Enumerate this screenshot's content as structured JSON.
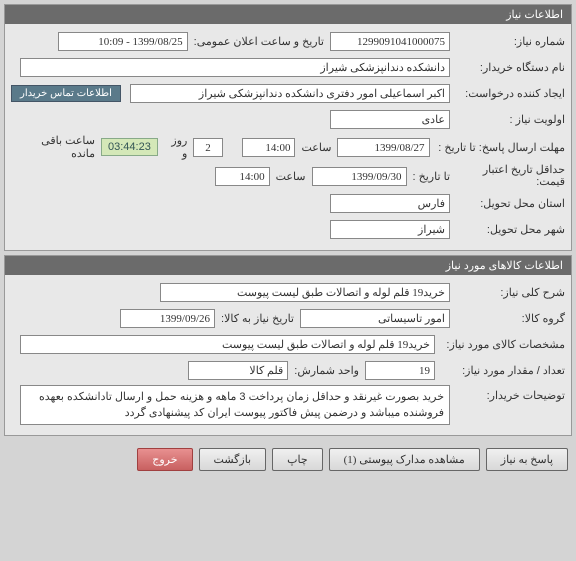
{
  "section1": {
    "title": "اطلاعات نیاز",
    "need_number_label": "شماره نیاز:",
    "need_number": "1299091041000075",
    "publish_label": "تاریخ و ساعت اعلان عمومی:",
    "publish_value": "1399/08/25 - 10:09",
    "buyer_org_label": "نام دستگاه خریدار:",
    "buyer_org": "دانشکده دندانپزشکی شیراز",
    "creator_label": "ایجاد کننده درخواست:",
    "creator": "اکبر اسماعیلی امور دفتری دانشکده دندانپزشکی شیراز",
    "priority_label": "اولویت نیاز :",
    "priority": "عادی",
    "contact_link": "اطلاعات تماس خریدار",
    "reply_deadline_label": "مهلت ارسال پاسخ:  تا تاریخ :",
    "reply_deadline_date": "1399/08/27",
    "time_label": "ساعت",
    "reply_deadline_time": "14:00",
    "days_value": "2",
    "days_unit": "روز و",
    "timer": "03:44:23",
    "remaining": "ساعت باقی مانده",
    "min_credit_label": "حداقل تاریخ اعتبار قیمت:",
    "to_date_label": "تا تاریخ :",
    "min_credit_date": "1399/09/30",
    "min_credit_time": "14:00",
    "province_label": "استان محل تحویل:",
    "province": "فارس",
    "city_label": "شهر محل تحویل:",
    "city": "شیراز"
  },
  "section2": {
    "title": "اطلاعات کالاهای مورد نیاز",
    "need_summary_label": "شرح کلی نیاز:",
    "need_summary": "خرید19 قلم لوله و اتصالات طبق لیست پیوست",
    "goods_group_label": "گروه کالا:",
    "goods_group": "امور تاسیساتی",
    "need_date_to_label": "تاریخ نیاز به کالا:",
    "need_date_to": "1399/09/26",
    "spec_label": "مشخصات کالای مورد نیاز:",
    "spec": "خرید19 قلم لوله و اتصالات طبق لیست پیوست",
    "qty_label": "تعداد / مقدار مورد نیاز:",
    "qty": "19",
    "unit_label": "واحد شمارش:",
    "unit": "قلم کالا",
    "buyer_notes_label": "توضیحات خریدار:",
    "buyer_notes": "خرید بصورت غیرنقد و حداقل زمان پرداخت 3 ماهه و هزینه حمل و ارسال تادانشکده بعهده فروشنده میباشد و درضمن پیش فاکتور پیوست ایران کد پیشنهادی گردد"
  },
  "buttons": {
    "respond": "پاسخ به نیاز",
    "view_attach": "مشاهده مدارک پیوستی (1)",
    "print": "چاپ",
    "back": "بازگشت",
    "exit": "خروج"
  }
}
